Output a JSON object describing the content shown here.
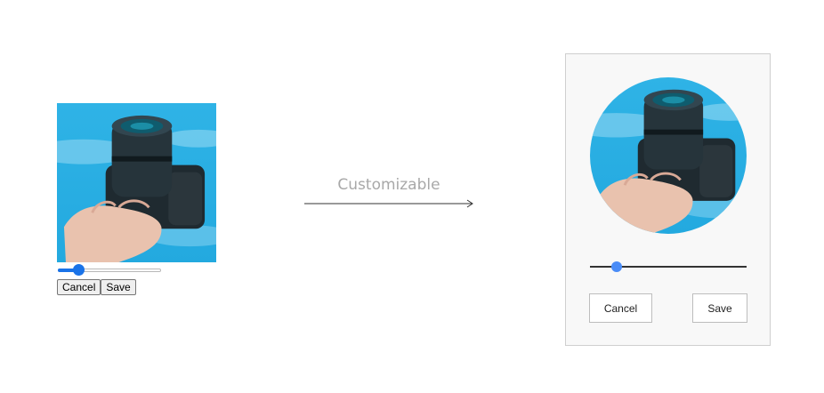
{
  "default_cropper": {
    "zoom_level": 0.2,
    "cancel_label": "Cancel",
    "save_label": "Save"
  },
  "transition": {
    "label": "Customizable"
  },
  "custom_cropper": {
    "zoom_level": 0.17,
    "cancel_label": "Cancel",
    "save_label": "Save",
    "accent_color": "#4a8cf7"
  },
  "colors": {
    "default_slider_accent": "#1a73e8",
    "panel_background": "#f8f8f8"
  }
}
